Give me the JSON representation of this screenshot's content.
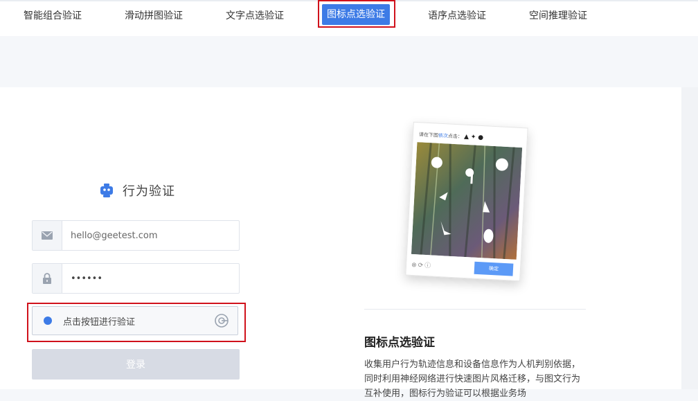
{
  "tabs": [
    {
      "label": "智能组合验证",
      "active": false
    },
    {
      "label": "滑动拼图验证",
      "active": false
    },
    {
      "label": "文字点选验证",
      "active": false
    },
    {
      "label": "图标点选验证",
      "active": true
    },
    {
      "label": "语序点选验证",
      "active": false
    },
    {
      "label": "空间推理验证",
      "active": false
    }
  ],
  "login": {
    "title": "行为验证",
    "email_placeholder": "hello@geetest.com",
    "password_value": "••••••",
    "verify_label": "点击按钮进行验证",
    "submit_label": "登录"
  },
  "demo": {
    "prompt_prefix": "请在下图",
    "prompt_highlight": "依次",
    "prompt_suffix": "点击：",
    "confirm_label": "确定"
  },
  "section": {
    "title": "图标点选验证",
    "description": "收集用户行为轨迹信息和设备信息作为人机判别依据，同时利用神经网络进行快速图片风格迁移，与图文行为互补使用，图标行为验证可以根据业务场"
  },
  "colors": {
    "accent": "#3d7be6",
    "highlight_outline": "#d0111b",
    "disabled_button": "#d7dbe4"
  }
}
